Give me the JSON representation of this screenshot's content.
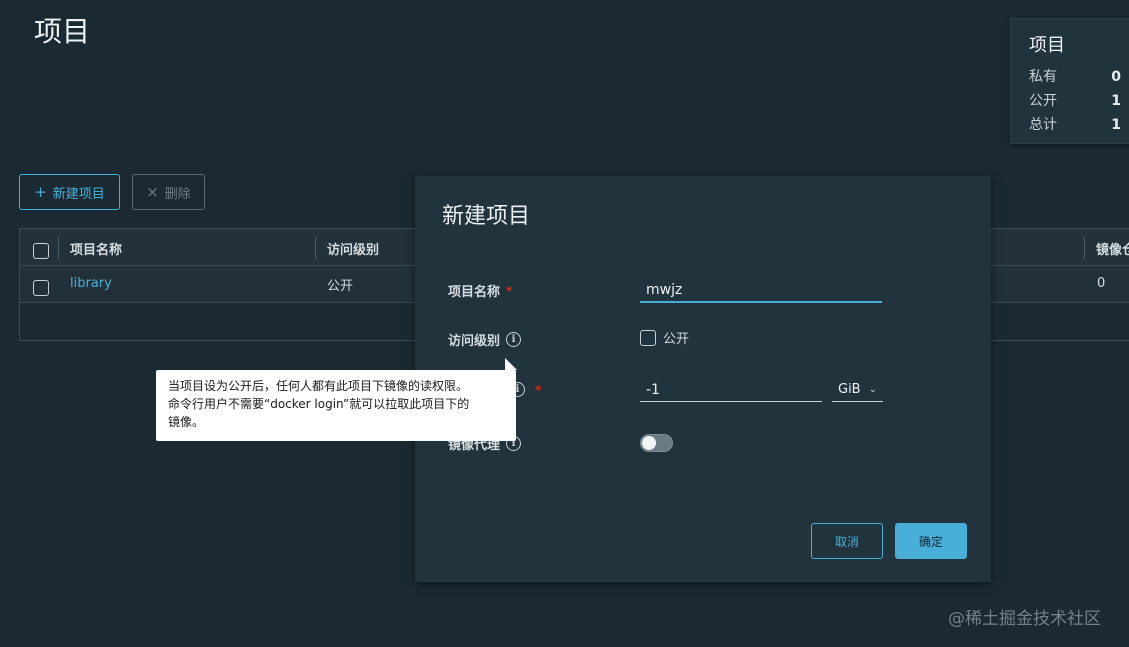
{
  "page": {
    "title": "项目"
  },
  "stats": {
    "title": "项目",
    "rows": [
      {
        "label": "私有",
        "value": "0"
      },
      {
        "label": "公开",
        "value": "1"
      },
      {
        "label": "总计",
        "value": "1"
      }
    ]
  },
  "toolbar": {
    "new_label": "新建项目",
    "delete_label": "删除"
  },
  "table": {
    "columns": [
      "项目名称",
      "访问级别",
      "镜像仓"
    ],
    "rows": [
      {
        "name": "library",
        "access": "公开",
        "repos": "0"
      }
    ]
  },
  "modal": {
    "title": "新建项目",
    "fields": {
      "name_label": "项目名称",
      "name_value": "mwjz",
      "access_label": "访问级别",
      "public_label": "公开",
      "quota_value": "-1",
      "quota_unit": "GiB",
      "proxy_label": "镜像代理"
    },
    "cancel_label": "取消",
    "ok_label": "确定"
  },
  "tooltip": {
    "line1": "当项目设为公开后，任何人都有此项目下镜像的读权限。",
    "line2": "命令行用户不需要“docker login”就可以拉取此项目下的",
    "line3": "镜像。"
  },
  "watermark": "@稀土掘金技术社区",
  "colors": {
    "accent": "#49afd9",
    "background": "#1b2a32",
    "required": "#e62700"
  }
}
